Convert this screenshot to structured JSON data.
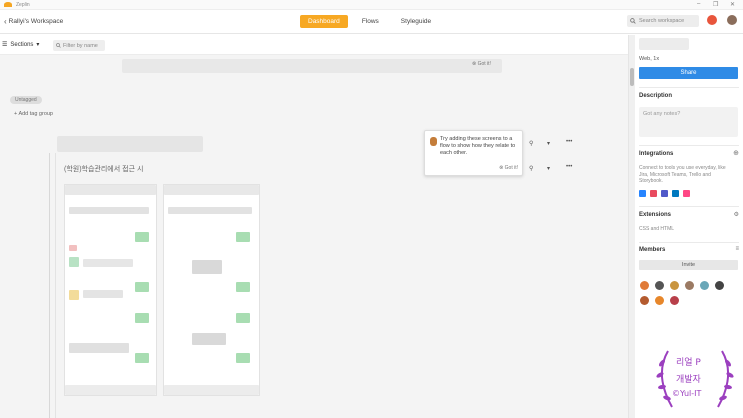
{
  "window": {
    "app_title": "Zeplin"
  },
  "nav": {
    "back_label": "Rallyi's Workspace",
    "tabs": [
      {
        "label": "Dashboard",
        "active": true
      },
      {
        "label": "Flows",
        "active": false
      },
      {
        "label": "Styleguide",
        "active": false
      }
    ],
    "search_placeholder": "Search workspace"
  },
  "toolbar": {
    "sections_label": "Sections",
    "filter_placeholder": "Filter by name"
  },
  "banner": {
    "got_it": "Got it!"
  },
  "tags": {
    "untagged": "Untagged",
    "add_tag_group": "Add tag group"
  },
  "group": {
    "title": "(학원)학습관리에서 접근 시"
  },
  "tooltip": {
    "text": "Try adding these screens to a flow to show how they relate to each other.",
    "got_it": "Got it!"
  },
  "panel": {
    "platform": "Web, 1x",
    "share_label": "Share",
    "description_heading": "Description",
    "description_placeholder": "Got any notes?",
    "integrations_heading": "Integrations",
    "integrations_text": "Connect to tools you use everyday, like Jira, Microsoft Teams, Trello and Storybook.",
    "extensions_heading": "Extensions",
    "extensions_text": "CSS and HTML",
    "members_heading": "Members",
    "invite_label": "Invite"
  },
  "watermark": {
    "line1": "리얼 P",
    "line2": "개발자",
    "line3": "©Yul-IT"
  },
  "colors": {
    "accent": "#f7a823",
    "share": "#2f8be6",
    "watermark": "#9b3fbf"
  }
}
